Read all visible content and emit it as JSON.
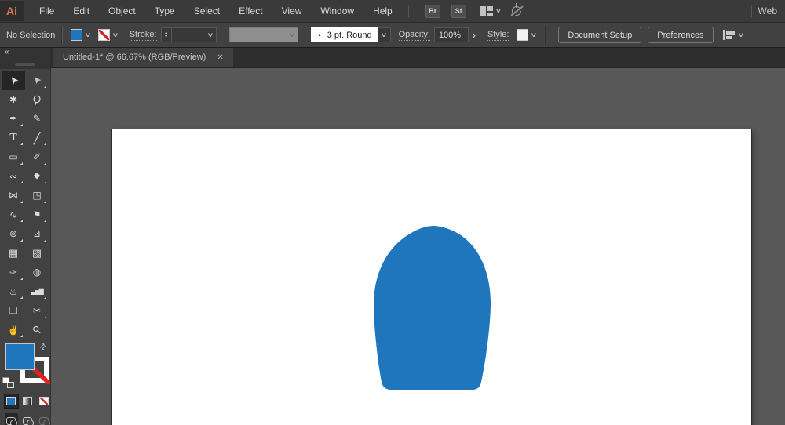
{
  "app": {
    "brand": "Ai",
    "workspace": "Web"
  },
  "menubar": {
    "items": [
      "File",
      "Edit",
      "Object",
      "Type",
      "Select",
      "Effect",
      "View",
      "Window",
      "Help"
    ],
    "br_label": "Br",
    "st_label": "St"
  },
  "controlbar": {
    "selection_status": "No Selection",
    "stroke_label": "Stroke:",
    "brush_bullet": "•",
    "brush_value": "3 pt. Round",
    "opacity_label": "Opacity:",
    "opacity_value": "100%",
    "style_label": "Style:",
    "document_setup_label": "Document Setup",
    "preferences_label": "Preferences"
  },
  "tabbar": {
    "title": "Untitled-1* @ 66.67% (RGB/Preview)"
  },
  "toolbar": {
    "tools": [
      {
        "name": "selection-tool",
        "glyph": "➤",
        "selected": true,
        "flyout": false
      },
      {
        "name": "direct-selection-tool",
        "glyph": "➤",
        "selected": false,
        "flyout": true
      },
      {
        "name": "magic-wand-tool",
        "glyph": "✱",
        "selected": false,
        "flyout": false
      },
      {
        "name": "lasso-tool",
        "glyph": "Ϙ",
        "selected": false,
        "flyout": false
      },
      {
        "name": "pen-tool",
        "glyph": "✒",
        "selected": false,
        "flyout": true
      },
      {
        "name": "curvature-tool",
        "glyph": "✎",
        "selected": false,
        "flyout": false
      },
      {
        "name": "type-tool",
        "glyph": "T",
        "selected": false,
        "flyout": true
      },
      {
        "name": "line-segment-tool",
        "glyph": "╱",
        "selected": false,
        "flyout": true
      },
      {
        "name": "rectangle-tool",
        "glyph": "▭",
        "selected": false,
        "flyout": true
      },
      {
        "name": "paintbrush-tool",
        "glyph": "✐",
        "selected": false,
        "flyout": true
      },
      {
        "name": "shaper-tool",
        "glyph": "∾",
        "selected": false,
        "flyout": true
      },
      {
        "name": "eraser-tool",
        "glyph": "◆",
        "selected": false,
        "flyout": true
      },
      {
        "name": "reflect-tool",
        "glyph": "⋈",
        "selected": false,
        "flyout": true
      },
      {
        "name": "scale-tool",
        "glyph": "◳",
        "selected": false,
        "flyout": true
      },
      {
        "name": "width-tool",
        "glyph": "∿",
        "selected": false,
        "flyout": true
      },
      {
        "name": "puppet-warp-tool",
        "glyph": "⚑",
        "selected": false,
        "flyout": true
      },
      {
        "name": "shape-builder-tool",
        "glyph": "⊚",
        "selected": false,
        "flyout": true
      },
      {
        "name": "perspective-grid-tool",
        "glyph": "⊿",
        "selected": false,
        "flyout": true
      },
      {
        "name": "mesh-tool",
        "glyph": "▦",
        "selected": false,
        "flyout": false
      },
      {
        "name": "gradient-tool",
        "glyph": "▧",
        "selected": false,
        "flyout": false
      },
      {
        "name": "eyedropper-tool",
        "glyph": "✑",
        "selected": false,
        "flyout": true
      },
      {
        "name": "blend-tool",
        "glyph": "◍",
        "selected": false,
        "flyout": false
      },
      {
        "name": "symbol-sprayer-tool",
        "glyph": "♨",
        "selected": false,
        "flyout": true
      },
      {
        "name": "column-graph-tool",
        "glyph": "▃▅▇",
        "selected": false,
        "flyout": true
      },
      {
        "name": "artboard-tool",
        "glyph": "❏",
        "selected": false,
        "flyout": false
      },
      {
        "name": "slice-tool",
        "glyph": "✂",
        "selected": false,
        "flyout": true
      },
      {
        "name": "hand-tool",
        "glyph": "✌",
        "selected": false,
        "flyout": true
      },
      {
        "name": "zoom-tool",
        "glyph": "⚲",
        "selected": false,
        "flyout": false
      }
    ]
  },
  "icons": {
    "chevron_down": "∨",
    "stepper_up": "▴",
    "stepper_down": "▾",
    "panel_arrow": "›",
    "close": "✕",
    "collapse": "«",
    "swap": "⇄"
  },
  "artwork": {
    "fill_color": "#1f76bd"
  },
  "colors": {
    "accent_blue": "#1f76bd",
    "none_red": "#dd2222",
    "pasteboard": "#585858",
    "artboard": "#ffffff"
  }
}
